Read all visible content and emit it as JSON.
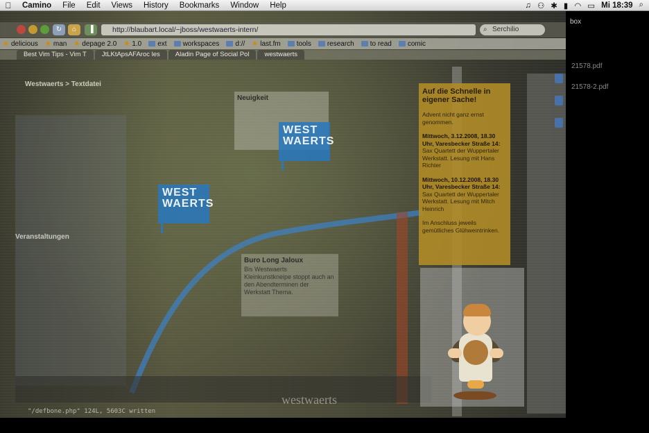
{
  "menubar": {
    "apple": "",
    "app_name": "Camino",
    "items": [
      "File",
      "Edit",
      "Views",
      "History",
      "Bookmarks",
      "Window",
      "Help"
    ],
    "clock": "Mi 18:39"
  },
  "browser": {
    "url": "http://blaubart.local/~jboss/westwaerts-intern/",
    "search": "Serchilio",
    "bookmarks": [
      {
        "label": "delicious",
        "icon": "star-icon"
      },
      {
        "label": "man",
        "icon": "star-icon"
      },
      {
        "label": "depage 2.0",
        "icon": "star-icon"
      },
      {
        "label": "1.0",
        "icon": "star-icon"
      },
      {
        "label": "ext",
        "icon": "folder-icon"
      },
      {
        "label": "workspaces",
        "icon": "folder-icon"
      },
      {
        "label": "d://",
        "icon": "folder-icon"
      },
      {
        "label": "last.fm",
        "icon": "star-icon"
      },
      {
        "label": "tools",
        "icon": "folder-icon"
      },
      {
        "label": "research",
        "icon": "folder-icon"
      },
      {
        "label": "to read",
        "icon": "folder-icon"
      },
      {
        "label": "comic",
        "icon": "folder-icon"
      }
    ],
    "tabs": [
      "Best Vim Tips - Vim T",
      "JtLKtApsAFAroc les",
      "Aladin Page of Social Pol",
      "westwaerts"
    ]
  },
  "page": {
    "breadcrumb": "Westwaerts > Textdatei",
    "left_heading": "Veranstaltungen",
    "news_title": "Neuigkeit",
    "logo_text": "WEST WAERTS",
    "info_title": "Buro Long Jaloux",
    "info_text": "Bis Westwaerts Kleinkunstkneipe stoppt auch an den Abendterminen der Werkstatt Thema.",
    "footer_logo": "westwaerts",
    "status_text": "\"/defbone.php\" 124L, 5603C written"
  },
  "sidebar": {
    "heading": "Auf die Schnelle in eigener Sache!",
    "intro": "Advent nicht ganz ernst genommen.",
    "event1_when": "Mittwoch, 3.12.2008, 18.30 Uhr, Varesbecker Straße 14:",
    "event1_desc": "Sax Quartett der Wuppertaler Werkstatt. Lesung mit Hans Richter",
    "event2_when": "Mittwoch, 10.12.2008, 18.30 Uhr, Varesbecker Straße 14:",
    "event2_desc": "Sax Quartett der Wuppertaler Werkstatt. Lesung mit Mitch Heinrich",
    "outro": "Im Anschluss jeweils gemütliches Glühweintrinken."
  },
  "desktop": {
    "folder_label": "box",
    "file1": "21578.pdf",
    "file2": "21578-2.pdf"
  }
}
